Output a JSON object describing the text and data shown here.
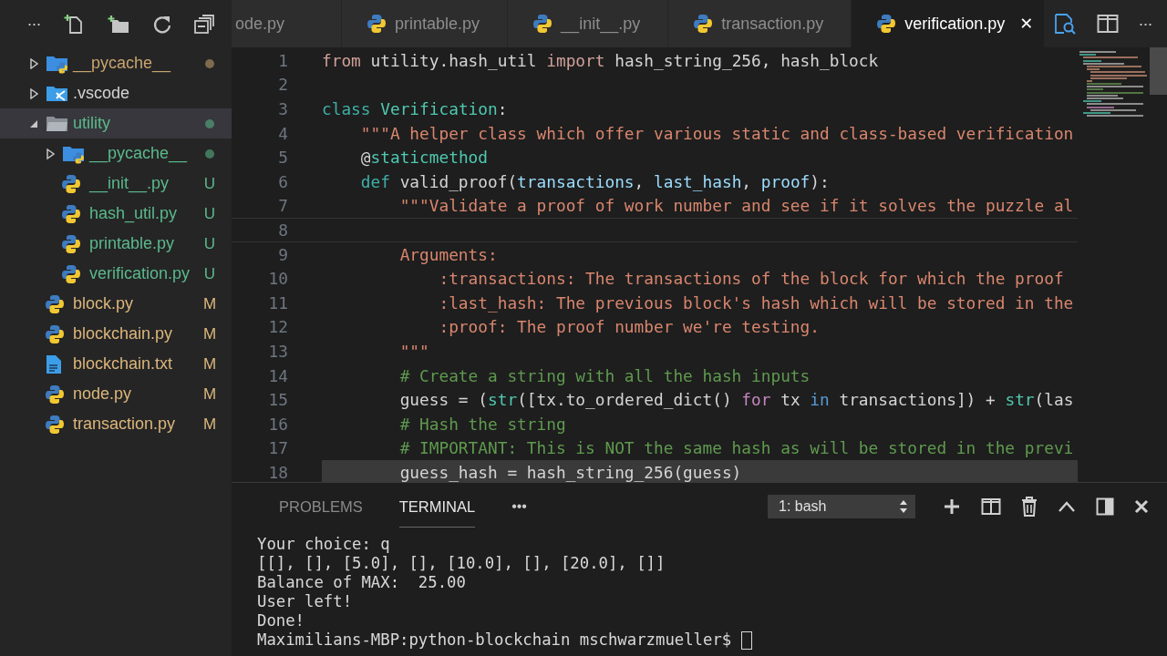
{
  "sidebar": {
    "more": "...",
    "tree": [
      {
        "name": "__pycache__",
        "kind": "package",
        "expanded": false,
        "selected": false,
        "color": "#c9a46e",
        "dot": true
      },
      {
        "name": ".vscode",
        "kind": "config",
        "expanded": false,
        "selected": false,
        "color": "#d4d4d4",
        "dot": false
      },
      {
        "name": "utility",
        "kind": "folder",
        "expanded": true,
        "selected": true,
        "color": "#5bb98b",
        "dot": true,
        "children": [
          {
            "name": "__pycache__",
            "kind": "package",
            "expanded": false,
            "selected": false,
            "color": "#5bb98b",
            "dot": true
          },
          {
            "name": "__init__.py",
            "kind": "python",
            "selected": false,
            "color": "#5bb98b",
            "badge": "U"
          },
          {
            "name": "hash_util.py",
            "kind": "python",
            "selected": false,
            "color": "#5bb98b",
            "badge": "U"
          },
          {
            "name": "printable.py",
            "kind": "python",
            "selected": false,
            "color": "#5bb98b",
            "badge": "U"
          },
          {
            "name": "verification.py",
            "kind": "python",
            "selected": false,
            "color": "#5bb98b",
            "badge": "U"
          }
        ]
      },
      {
        "name": "block.py",
        "kind": "python",
        "selected": false,
        "color": "#dcb67a",
        "badge": "M"
      },
      {
        "name": "blockchain.py",
        "kind": "python",
        "selected": false,
        "color": "#dcb67a",
        "badge": "M"
      },
      {
        "name": "blockchain.txt",
        "kind": "text",
        "selected": false,
        "color": "#dcb67a",
        "badge": "M"
      },
      {
        "name": "node.py",
        "kind": "python",
        "selected": false,
        "color": "#dcb67a",
        "badge": "M"
      },
      {
        "name": "transaction.py",
        "kind": "python",
        "selected": false,
        "color": "#dcb67a",
        "badge": "M"
      }
    ]
  },
  "tabs": [
    {
      "label": "ode.py",
      "kind": "partial",
      "selected": false
    },
    {
      "label": "printable.py",
      "kind": "python",
      "selected": false
    },
    {
      "label": "__init__.py",
      "kind": "python",
      "selected": false
    },
    {
      "label": "transaction.py",
      "kind": "python",
      "selected": false
    },
    {
      "label": "verification.py",
      "kind": "python",
      "selected": true,
      "close": "✕"
    }
  ],
  "editor_actions": {
    "more": "..."
  },
  "editor": {
    "lines": [
      {
        "number": "1",
        "current": false,
        "highlighted": false,
        "tokens": [
          {
            "text": "from",
            "kind": "import"
          },
          {
            "text": " utility.hash_util ",
            "kind": "plain"
          },
          {
            "text": "import",
            "kind": "import"
          },
          {
            "text": " hash_string_256, hash_block",
            "kind": "plain"
          }
        ]
      },
      {
        "number": "2",
        "current": false,
        "highlighted": false
      },
      {
        "number": "3",
        "current": false,
        "highlighted": false,
        "tokens": [
          {
            "text": "class",
            "kind": "storage"
          },
          {
            "text": " Verification",
            "kind": "type"
          },
          {
            "text": ":",
            "kind": "plain"
          }
        ]
      },
      {
        "number": "4",
        "current": false,
        "highlighted": false,
        "tokens": [
          {
            "text": "    \"\"\"A helper class which offer various static and class-based verification",
            "kind": "string"
          }
        ]
      },
      {
        "number": "5",
        "current": false,
        "highlighted": false,
        "tokens": [
          {
            "text": "    @",
            "kind": "plain"
          },
          {
            "text": "staticmethod",
            "kind": "type"
          }
        ]
      },
      {
        "number": "6",
        "current": false,
        "highlighted": false,
        "tokens": [
          {
            "text": "    def",
            "kind": "storage"
          },
          {
            "text": " valid_proof(",
            "kind": "plain"
          },
          {
            "text": "transactions",
            "kind": "param"
          },
          {
            "text": ", ",
            "kind": "plain"
          },
          {
            "text": "last_hash",
            "kind": "param"
          },
          {
            "text": ", ",
            "kind": "plain"
          },
          {
            "text": "proof",
            "kind": "param"
          },
          {
            "text": "):",
            "kind": "plain"
          }
        ]
      },
      {
        "number": "7",
        "current": false,
        "highlighted": false,
        "tokens": [
          {
            "text": "        \"\"\"Validate a proof of work number and see if it solves the puzzle al",
            "kind": "string"
          }
        ]
      },
      {
        "number": "8",
        "current": true,
        "highlighted": false
      },
      {
        "number": "9",
        "current": false,
        "highlighted": false,
        "tokens": [
          {
            "text": "        Arguments:",
            "kind": "string"
          }
        ]
      },
      {
        "number": "10",
        "current": false,
        "highlighted": false,
        "tokens": [
          {
            "text": "            :transactions: The transactions of the block for which the proof",
            "kind": "string"
          }
        ]
      },
      {
        "number": "11",
        "current": false,
        "highlighted": false,
        "tokens": [
          {
            "text": "            :last_hash: The previous block's hash which will be stored in the",
            "kind": "string"
          }
        ]
      },
      {
        "number": "12",
        "current": false,
        "highlighted": false,
        "tokens": [
          {
            "text": "            :proof: The proof number we're testing.",
            "kind": "string"
          }
        ]
      },
      {
        "number": "13",
        "current": false,
        "highlighted": false,
        "tokens": [
          {
            "text": "        \"\"\"",
            "kind": "string"
          }
        ]
      },
      {
        "number": "14",
        "current": false,
        "highlighted": false,
        "tokens": [
          {
            "text": "        # Create a string with all the hash inputs",
            "kind": "comment"
          }
        ]
      },
      {
        "number": "15",
        "current": false,
        "highlighted": false,
        "tokens": [
          {
            "text": "        guess = (",
            "kind": "plain"
          },
          {
            "text": "str",
            "kind": "type"
          },
          {
            "text": "([tx.to_ordered_dict() ",
            "kind": "plain"
          },
          {
            "text": "for",
            "kind": "control"
          },
          {
            "text": " tx ",
            "kind": "plain"
          },
          {
            "text": "in",
            "kind": "operator"
          },
          {
            "text": " transactions]) + ",
            "kind": "plain"
          },
          {
            "text": "str",
            "kind": "type"
          },
          {
            "text": "(las",
            "kind": "plain"
          }
        ]
      },
      {
        "number": "16",
        "current": false,
        "highlighted": false,
        "tokens": [
          {
            "text": "        # Hash the string",
            "kind": "comment"
          }
        ]
      },
      {
        "number": "17",
        "current": false,
        "highlighted": false,
        "tokens": [
          {
            "text": "        # IMPORTANT: This is NOT the same hash as will be stored in the previ",
            "kind": "comment"
          }
        ]
      },
      {
        "number": "18",
        "current": false,
        "highlighted": true,
        "tokens": [
          {
            "text": "        guess_hash = hash_string_256(guess)",
            "kind": "plain"
          }
        ]
      }
    ]
  },
  "panel": {
    "tabs": [
      {
        "label": "PROBLEMS",
        "selected": false
      },
      {
        "label": "TERMINAL",
        "selected": true
      }
    ],
    "more": "•••",
    "terminal_select": "1: bash",
    "terminal": [
      "Your choice: q",
      "[[], [], [5.0], [], [10.0], [], [20.0], []]",
      "Balance of MAX:  25.00",
      "User left!",
      "Done!"
    ],
    "prompt": "Maximilians-MBP:python-blockchain mschwarzmueller$"
  }
}
